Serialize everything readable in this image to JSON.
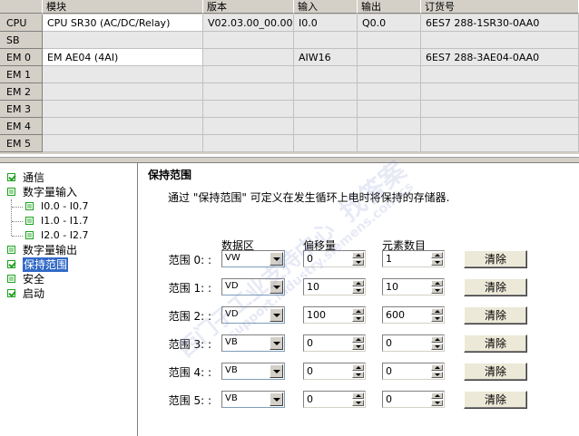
{
  "table": {
    "headers": [
      "模块",
      "版本",
      "输入",
      "输出",
      "订货号"
    ],
    "rows": [
      {
        "slot": "CPU",
        "module": "CPU SR30 (AC/DC/Relay)",
        "version": "V02.03.00_00.00...",
        "input": "I0.0",
        "output": "Q0.0",
        "order": "6ES7 288-1SR30-0AA0"
      },
      {
        "slot": "SB",
        "module": "",
        "version": "",
        "input": "",
        "output": "",
        "order": ""
      },
      {
        "slot": "EM 0",
        "module": "EM AE04 (4AI)",
        "version": "",
        "input": "AIW16",
        "output": "",
        "order": "6ES7 288-3AE04-0AA0"
      },
      {
        "slot": "EM 1",
        "module": "",
        "version": "",
        "input": "",
        "output": "",
        "order": ""
      },
      {
        "slot": "EM 2",
        "module": "",
        "version": "",
        "input": "",
        "output": "",
        "order": ""
      },
      {
        "slot": "EM 3",
        "module": "",
        "version": "",
        "input": "",
        "output": "",
        "order": ""
      },
      {
        "slot": "EM 4",
        "module": "",
        "version": "",
        "input": "",
        "output": "",
        "order": ""
      },
      {
        "slot": "EM 5",
        "module": "",
        "version": "",
        "input": "",
        "output": "",
        "order": ""
      }
    ]
  },
  "tree": {
    "items": [
      {
        "label": "通信",
        "icon": "checkbox-checked"
      },
      {
        "label": "数字量输入",
        "icon": "checkbox-partial"
      },
      {
        "label": "I0.0 - I0.7",
        "icon": "checkbox-partial"
      },
      {
        "label": "I1.0 - I1.7",
        "icon": "checkbox-partial"
      },
      {
        "label": "I2.0 - I2.7",
        "icon": "checkbox-partial"
      },
      {
        "label": "数字量输出",
        "icon": "checkbox-partial"
      },
      {
        "label": "保持范围",
        "icon": "checkbox-checked"
      },
      {
        "label": "安全",
        "icon": "checkbox-partial"
      },
      {
        "label": "启动",
        "icon": "checkbox-checked"
      }
    ]
  },
  "retain": {
    "title": "保持范围",
    "description": "通过 \"保持范围\" 可定义在发生循环上电时将保持的存储器.",
    "col_area": "数据区",
    "col_offset": "偏移量",
    "col_count": "元素数目",
    "clear_label": "清除",
    "ranges": [
      {
        "label": "范围 0: :",
        "area": "VW",
        "offset": "0",
        "count": "1"
      },
      {
        "label": "范围 1: :",
        "area": "VD",
        "offset": "10",
        "count": "10"
      },
      {
        "label": "范围 2: :",
        "area": "VD",
        "offset": "100",
        "count": "600"
      },
      {
        "label": "范围 3: :",
        "area": "VB",
        "offset": "0",
        "count": "0"
      },
      {
        "label": "范围 4: :",
        "area": "VB",
        "offset": "0",
        "count": "0"
      },
      {
        "label": "范围 5: :",
        "area": "VB",
        "offset": "0",
        "count": "0"
      }
    ]
  },
  "watermark": {
    "text1": "找答案",
    "text2": "西门子工业支持中心",
    "text3": "support.industry.siemens.com/cs"
  }
}
